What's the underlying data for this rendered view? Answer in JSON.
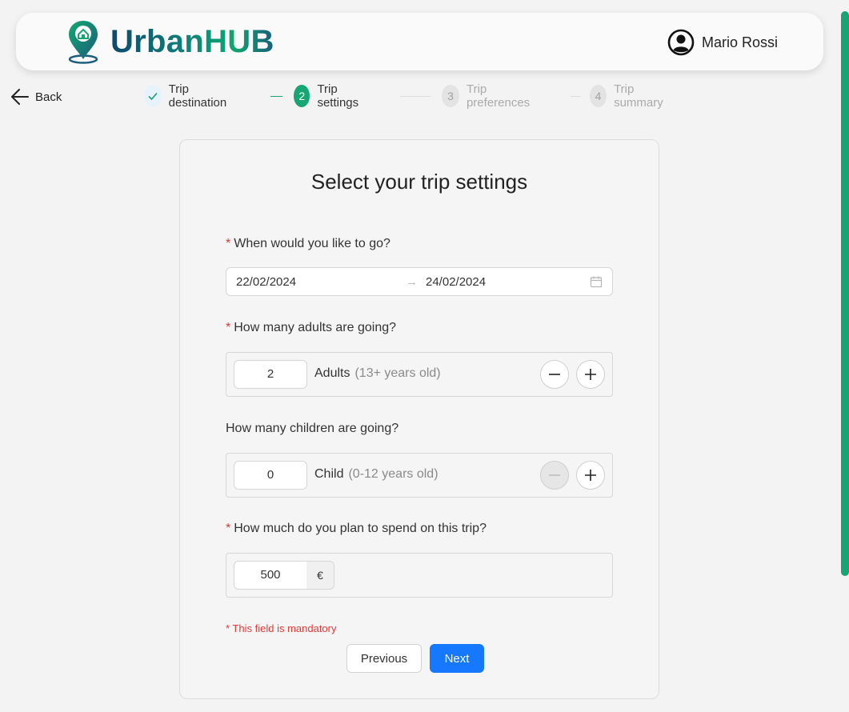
{
  "header": {
    "brand": "UrbanHUB",
    "user_name": "Mario Rossi"
  },
  "nav": {
    "back_label": "Back"
  },
  "steps": [
    {
      "number": "",
      "label": "Trip destination",
      "state": "done"
    },
    {
      "number": "2",
      "label": "Trip settings",
      "state": "active"
    },
    {
      "number": "3",
      "label": "Trip preferences",
      "state": "pending"
    },
    {
      "number": "4",
      "label": "Trip summary",
      "state": "pending"
    }
  ],
  "form": {
    "title": "Select your trip settings",
    "dates": {
      "question": "When would you like to go?",
      "required": "*",
      "start": "22/02/2024",
      "end": "24/02/2024"
    },
    "adults": {
      "question": "How many adults are going?",
      "required": "*",
      "value": "2",
      "label": "Adults",
      "sublabel": "(13+ years old)"
    },
    "children": {
      "question": "How many children are going?",
      "value": "0",
      "label": "Child",
      "sublabel": "(0-12 years old)"
    },
    "budget": {
      "question": "How much do you plan to spend on this trip?",
      "required": "*",
      "value": "500",
      "currency": "€"
    },
    "mandatory_note": "* This field is mandatory",
    "previous_label": "Previous",
    "next_label": "Next"
  },
  "colors": {
    "accent_green": "#17a673",
    "primary_blue": "#1677ff",
    "required_red": "#e53935"
  }
}
